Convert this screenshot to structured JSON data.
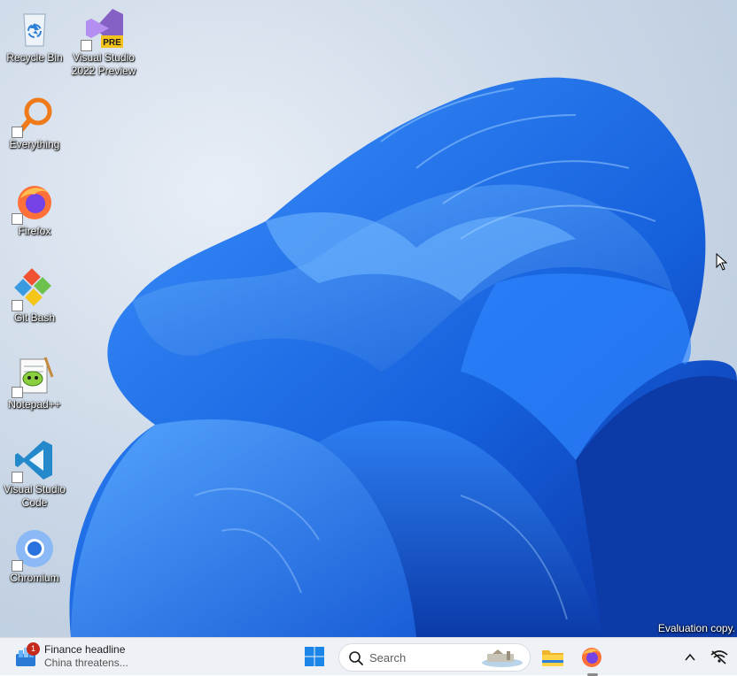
{
  "desktop": {
    "icons": [
      {
        "label": "Recycle Bin",
        "icon": "recycle-bin-icon"
      },
      {
        "label": "Visual Studio 2022 Preview",
        "icon": "visual-studio-preview-icon",
        "badge": "PRE"
      },
      {
        "label": "Everything",
        "icon": "everything-search-icon"
      },
      {
        "label": "Firefox",
        "icon": "firefox-icon"
      },
      {
        "label": "Git Bash",
        "icon": "git-bash-icon"
      },
      {
        "label": "Notepad++",
        "icon": "notepad-plus-plus-icon"
      },
      {
        "label": "Visual Studio Code",
        "icon": "vscode-icon"
      },
      {
        "label": "Chromium",
        "icon": "chromium-icon"
      }
    ],
    "watermark": "Evaluation copy."
  },
  "taskbar": {
    "widget": {
      "title": "Finance headline",
      "subtitle": "China threatens...",
      "badge_count": "1",
      "icon": "widgets-news-icon"
    },
    "start_icon": "windows-start-icon",
    "search": {
      "placeholder": "Search",
      "icon": "search-icon"
    },
    "pinned": [
      {
        "name": "File Explorer",
        "icon": "file-explorer-icon"
      },
      {
        "name": "Firefox",
        "icon": "firefox-icon",
        "running": true
      }
    ],
    "tray": [
      {
        "name": "Show hidden icons",
        "icon": "chevron-up-icon"
      },
      {
        "name": "Network disconnected",
        "icon": "network-disconnected-icon"
      }
    ]
  },
  "colors": {
    "accent": "#0067c0",
    "wallpaper_bloom": "#1a6fe0",
    "taskbar": "#eef1f5"
  }
}
